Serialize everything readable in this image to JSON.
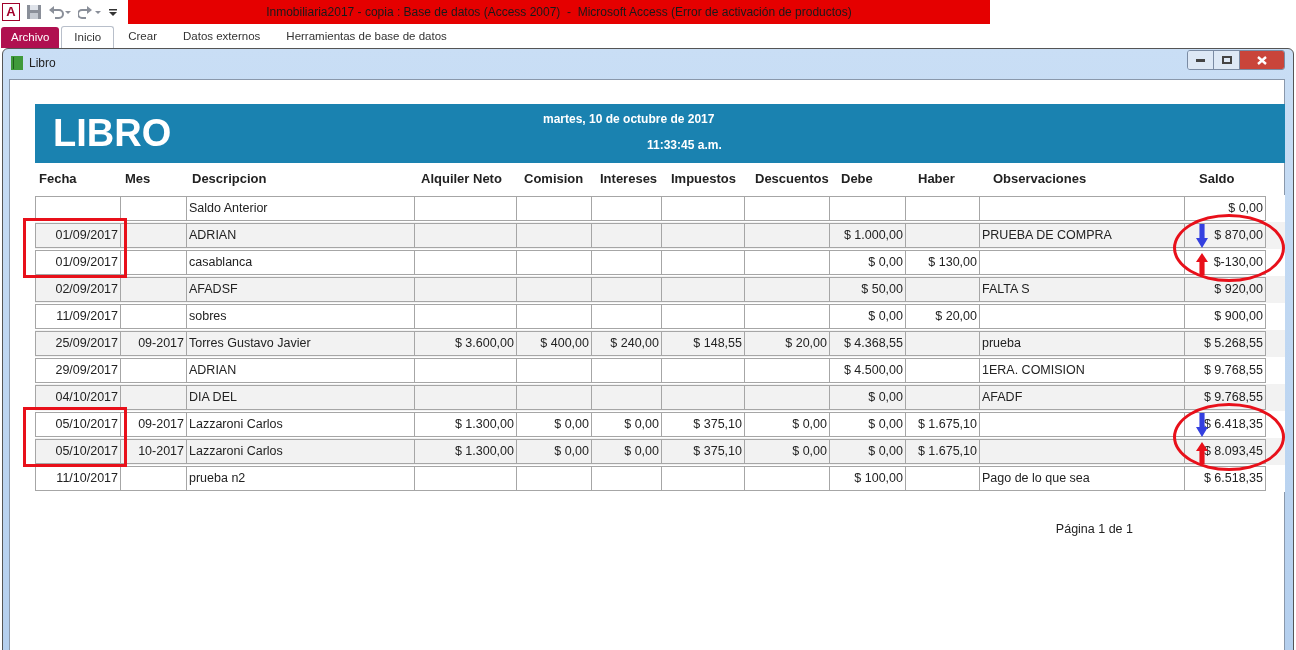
{
  "app": {
    "title": "Inmobiliaria2017 - copia : Base de datos (Access 2007)  -  Microsoft Access (Error de activación de productos)",
    "app_icon": "A"
  },
  "ribbon_tabs": [
    {
      "label": "Archivo",
      "kind": "file",
      "selected": false
    },
    {
      "label": "Inicio",
      "kind": "tab",
      "selected": true
    },
    {
      "label": "Crear",
      "kind": "tab",
      "selected": false
    },
    {
      "label": "Datos externos",
      "kind": "tab",
      "selected": false
    },
    {
      "label": "Herramientas de base de datos",
      "kind": "tab",
      "selected": false
    }
  ],
  "window": {
    "title": "Libro"
  },
  "report": {
    "title": "LIBRO",
    "date": "martes, 10 de octubre de 2017",
    "time": "11:33:45 a.m.",
    "columns": [
      "Fecha",
      "Mes",
      "Descripcion",
      "Alquiler Neto",
      "Comision",
      "Intereses",
      "Impuestos",
      "Descuentos",
      "Debe",
      "Haber",
      "Observaciones",
      "Saldo"
    ],
    "rows": [
      {
        "descripcion": "Saldo Anterior",
        "saldo": "$ 0,00"
      },
      {
        "fecha": "01/09/2017",
        "descripcion": "ADRIAN",
        "debe": "$ 1.000,00",
        "observaciones": "PRUEBA DE COMPRA",
        "saldo": "$ 870,00",
        "boxed": true,
        "circled": true,
        "down_arrow": true
      },
      {
        "fecha": "01/09/2017",
        "descripcion": "casablanca",
        "debe": "$ 0,00",
        "haber": "$ 130,00",
        "saldo": "$-130,00",
        "boxed": true,
        "circled": true,
        "up_arrow": true
      },
      {
        "fecha": "02/09/2017",
        "descripcion": "AFADSF",
        "debe": "$ 50,00",
        "observaciones": "FALTA S",
        "saldo": "$ 920,00"
      },
      {
        "fecha": "11/09/2017",
        "descripcion": "sobres",
        "debe": "$ 0,00",
        "haber": "$ 20,00",
        "saldo": "$ 900,00"
      },
      {
        "fecha": "25/09/2017",
        "mes": "09-2017",
        "descripcion": "Torres Gustavo Javier",
        "alquiler": "$ 3.600,00",
        "comision": "$ 400,00",
        "intereses": "$ 240,00",
        "impuestos": "$ 148,55",
        "descuentos": "$ 20,00",
        "debe": "$ 4.368,55",
        "observaciones": "prueba",
        "saldo": "$ 5.268,55"
      },
      {
        "fecha": "29/09/2017",
        "descripcion": "ADRIAN",
        "debe": "$ 4.500,00",
        "observaciones": "1ERA. COMISION",
        "saldo": "$ 9.768,55"
      },
      {
        "fecha": "04/10/2017",
        "descripcion": "DIA DEL",
        "debe": "$ 0,00",
        "observaciones": "AFADF",
        "saldo": "$ 9.768,55"
      },
      {
        "fecha": "05/10/2017",
        "mes": "09-2017",
        "descripcion": "Lazzaroni Carlos",
        "alquiler": "$ 1.300,00",
        "comision": "$ 0,00",
        "intereses": "$ 0,00",
        "impuestos": "$ 375,10",
        "descuentos": "$ 0,00",
        "debe": "$ 0,00",
        "haber": "$ 1.675,10",
        "saldo": "$ 6.418,35",
        "boxed": true,
        "circled": true,
        "down_arrow": true
      },
      {
        "fecha": "05/10/2017",
        "mes": "10-2017",
        "descripcion": "Lazzaroni Carlos",
        "alquiler": "$ 1.300,00",
        "comision": "$ 0,00",
        "intereses": "$ 0,00",
        "impuestos": "$ 375,10",
        "descuentos": "$ 0,00",
        "debe": "$ 0,00",
        "haber": "$ 1.675,10",
        "saldo": "$ 8.093,45",
        "boxed": true,
        "circled": true,
        "up_arrow": true
      },
      {
        "fecha": "11/10/2017",
        "descripcion": "prueba n2",
        "debe": "$ 100,00",
        "observaciones": "Pago de lo que sea",
        "saldo": "$ 6.518,35"
      }
    ],
    "page": "Página 1 de 1"
  }
}
